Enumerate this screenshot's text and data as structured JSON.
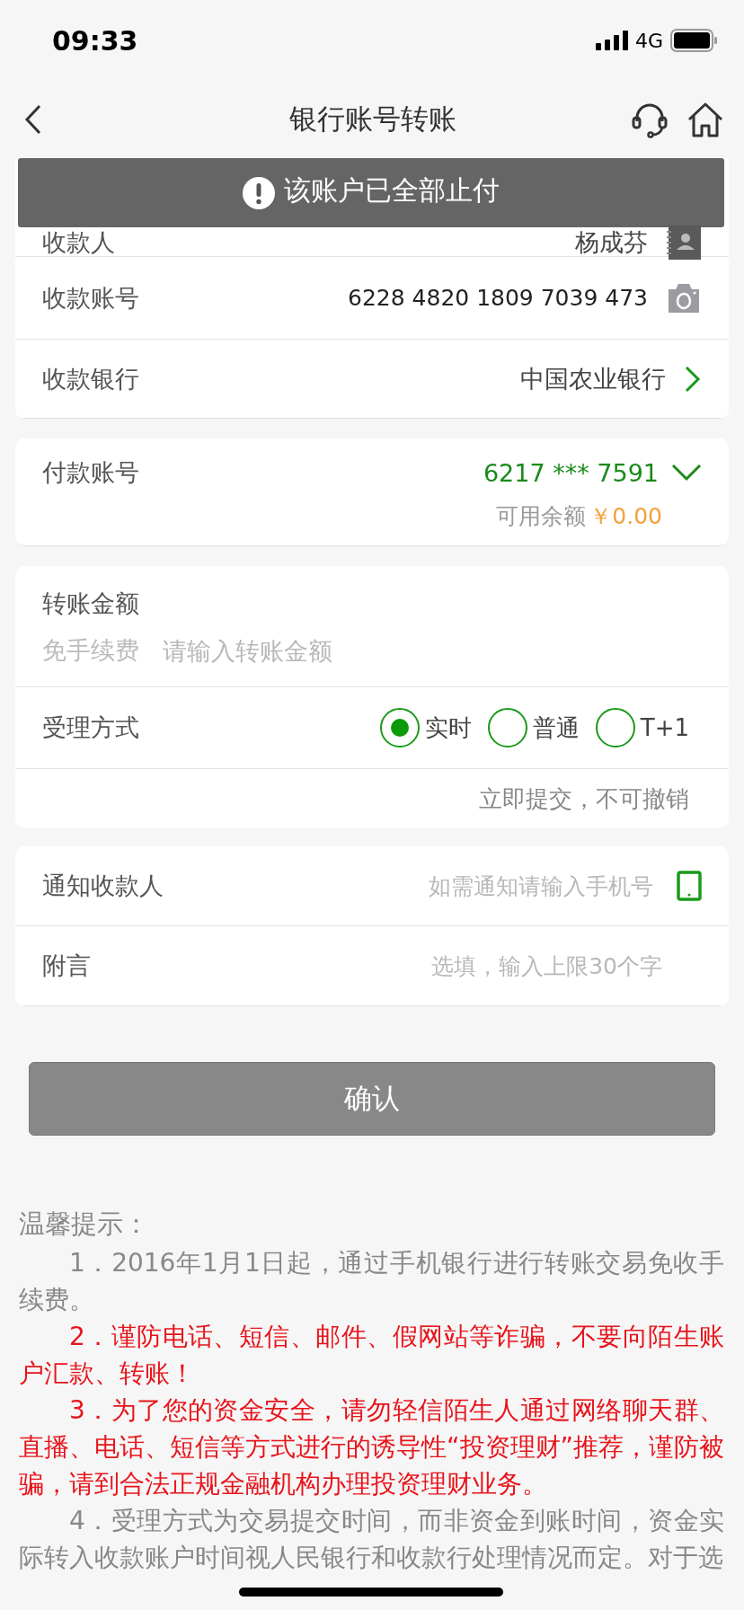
{
  "status_bar": {
    "time": "09:33",
    "network": "4G"
  },
  "nav": {
    "title": "银行账号转账"
  },
  "toast": {
    "text": "该账户已全部止付"
  },
  "payee": {
    "rows": [
      {
        "kind": "contact",
        "label": "收款人",
        "value": "杨成芬"
      },
      {
        "kind": "camera",
        "label": "收款账号",
        "value": "6228 4820 1809 7039 473"
      },
      {
        "kind": "link",
        "label": "收款银行",
        "value": "中国农业银行"
      }
    ]
  },
  "payer": {
    "label": "付款账号",
    "account": "6217 *** 7591",
    "balance_label": "可用余额",
    "balance": "￥0.00"
  },
  "amount": {
    "label": "转账金额",
    "fee_note": "免手续费",
    "placeholder": "请输入转账金额"
  },
  "processing": {
    "label": "受理方式",
    "options": [
      {
        "label": "实时",
        "selected": true
      },
      {
        "label": "普通",
        "selected": false
      },
      {
        "label": "T+1",
        "selected": false
      }
    ],
    "note": "立即提交，不可撤销"
  },
  "notify": {
    "rows": [
      {
        "kind": "phone",
        "label": "通知收款人",
        "placeholder": "如需通知请输入手机号"
      },
      {
        "kind": "plain",
        "label": "附言",
        "placeholder": "选填，输入上限30个字"
      }
    ]
  },
  "confirm_button": "确认",
  "tips": {
    "title": "温馨提示：",
    "items": [
      {
        "kind": "normal",
        "text": "1．2016年1月1日起，通过手机银行进行转账交易免收手续费。"
      },
      {
        "kind": "warning",
        "text": "2．谨防电话、短信、邮件、假网站等诈骗，不要向陌生账户汇款、转账！"
      },
      {
        "kind": "warning",
        "text": "3．为了您的资金安全，请勿轻信陌生人通过网络聊天群、直播、电话、短信等方式进行的诱导性“投资理财”推荐，谨防被骗，请到合法正规金融机构办理投资理财业务。"
      },
      {
        "kind": "normal",
        "text": "4．受理方式为交易提交时间，而非资金到账时间，资金实际转入收款账户时间视人民银行和收款行处理情况而定。对于选"
      }
    ]
  }
}
